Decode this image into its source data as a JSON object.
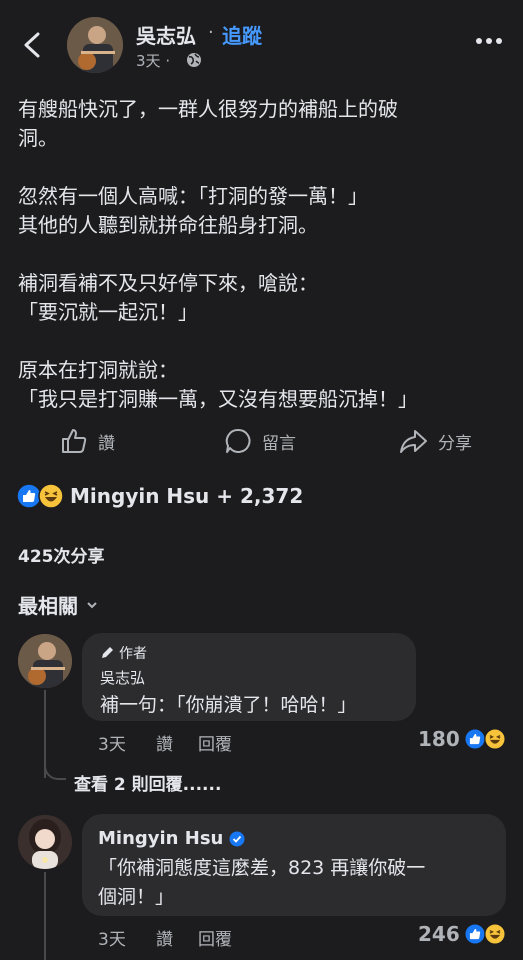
{
  "header": {
    "author": "吳志弘",
    "separator": "·",
    "follow_label": "追蹤",
    "time": "3天",
    "time_dot": "·"
  },
  "post": {
    "paragraphs": [
      "有艘船快沉了，一群人很努力的補船上的破\n洞。",
      "忽然有一個人高喊：「打洞的發一萬！」\n其他的人聽到就拼命往船身打洞。",
      "補洞看補不及只好停下來，嗆說：\n「要沉就一起沉！」",
      "原本在打洞就說：\n「我只是打洞賺一萬，又沒有想要船沉掉！」"
    ]
  },
  "actions": {
    "like_label": "讚",
    "comment_label": "留言",
    "share_label": "分享"
  },
  "reactions": {
    "text": "Mingyin Hsu + 2,372"
  },
  "shares": {
    "text": "425次分享"
  },
  "sort": {
    "label": "最相關"
  },
  "comments": [
    {
      "badge": "作者",
      "name": "吳志弘",
      "text": "補一句：「你崩潰了！哈哈！」",
      "time": "3天",
      "like": "讚",
      "reply": "回覆",
      "count": "180",
      "more_replies": "查看 2 則回覆......"
    },
    {
      "name": "Mingyin Hsu",
      "text": "「你補洞態度這麼差，823 再讓你破一\n個洞！」",
      "time": "3天",
      "like": "讚",
      "reply": "回覆",
      "count": "246"
    }
  ],
  "colors": {
    "background": "#1c1c1e",
    "accent": "#4599ff",
    "bubble": "#2c2c2f",
    "muted": "#b0b3b8"
  },
  "icons": [
    "back-arrow-icon",
    "globe-icon",
    "more-icon",
    "like-icon",
    "comment-icon",
    "share-icon",
    "like-reaction-icon",
    "haha-reaction-icon",
    "pencil-icon",
    "verified-icon",
    "chevron-down-icon"
  ]
}
